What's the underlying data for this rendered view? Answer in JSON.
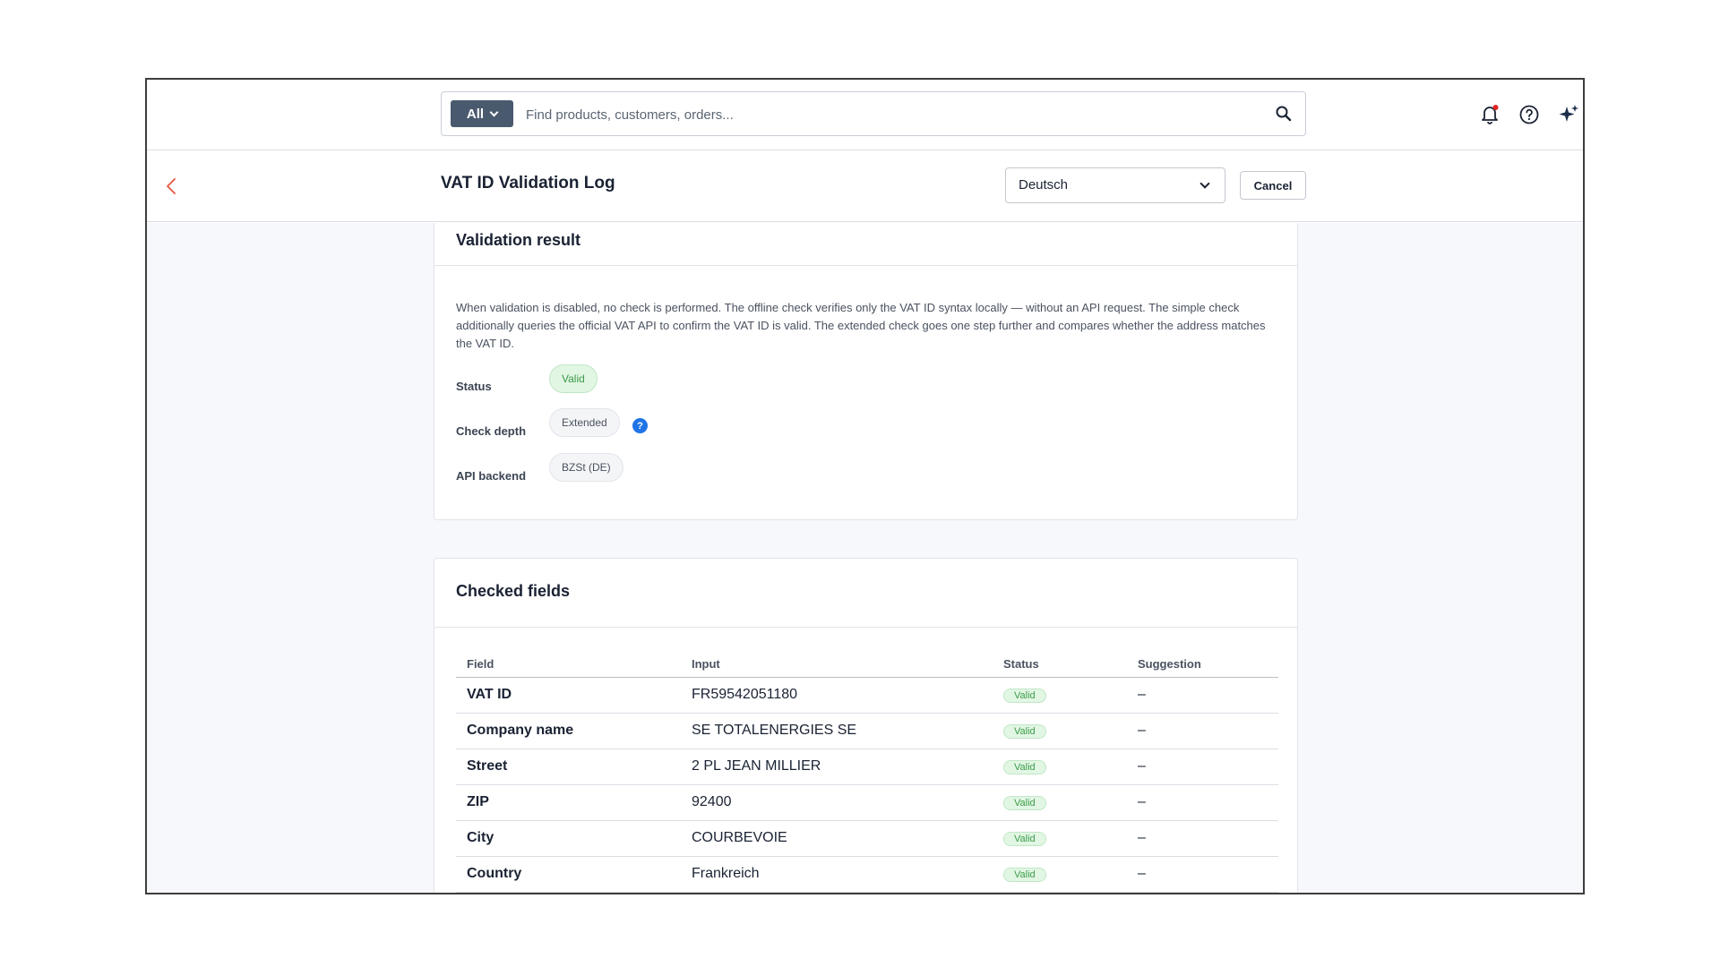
{
  "search": {
    "scope_label": "All",
    "placeholder": "Find products, customers, orders..."
  },
  "header": {
    "title": "VAT ID Validation Log",
    "language": "Deutsch",
    "cancel_label": "Cancel"
  },
  "validation_result": {
    "title": "Validation result",
    "description": "When validation is disabled, no check is performed. The offline check verifies only the VAT ID syntax locally — without an API request. The simple check additionally queries the official VAT API to confirm the VAT ID is valid. The extended check goes one step further and compares whether the address matches the VAT ID.",
    "status_label": "Status",
    "status_value": "Valid",
    "check_depth_label": "Check depth",
    "check_depth_value": "Extended",
    "api_backend_label": "API backend",
    "api_backend_value": "BZSt (DE)",
    "help_glyph": "?"
  },
  "checked_fields": {
    "title": "Checked fields",
    "columns": [
      "Field",
      "Input",
      "Status",
      "Suggestion"
    ],
    "rows": [
      {
        "field": "VAT ID",
        "input": "FR59542051180",
        "status": "Valid",
        "suggestion": "–"
      },
      {
        "field": "Company name",
        "input": "SE TOTALENERGIES SE",
        "status": "Valid",
        "suggestion": "–"
      },
      {
        "field": "Street",
        "input": "2 PL JEAN MILLIER",
        "status": "Valid",
        "suggestion": "–"
      },
      {
        "field": "ZIP",
        "input": "92400",
        "status": "Valid",
        "suggestion": "–"
      },
      {
        "field": "City",
        "input": "COURBEVOIE",
        "status": "Valid",
        "suggestion": "–"
      },
      {
        "field": "Country",
        "input": "Frankreich",
        "status": "Valid",
        "suggestion": "–"
      }
    ]
  },
  "icons": {
    "back": "chevron-left-icon",
    "search": "search-icon",
    "notifications": "bell-icon",
    "help": "help-circle-icon",
    "ai": "sparkles-icon"
  },
  "colors": {
    "accent_back": "#e8553f",
    "notification_dot": "#e02424",
    "valid_bg": "#e2f6e4",
    "valid_text": "#3a9c48",
    "help_blue": "#1f74e8"
  }
}
